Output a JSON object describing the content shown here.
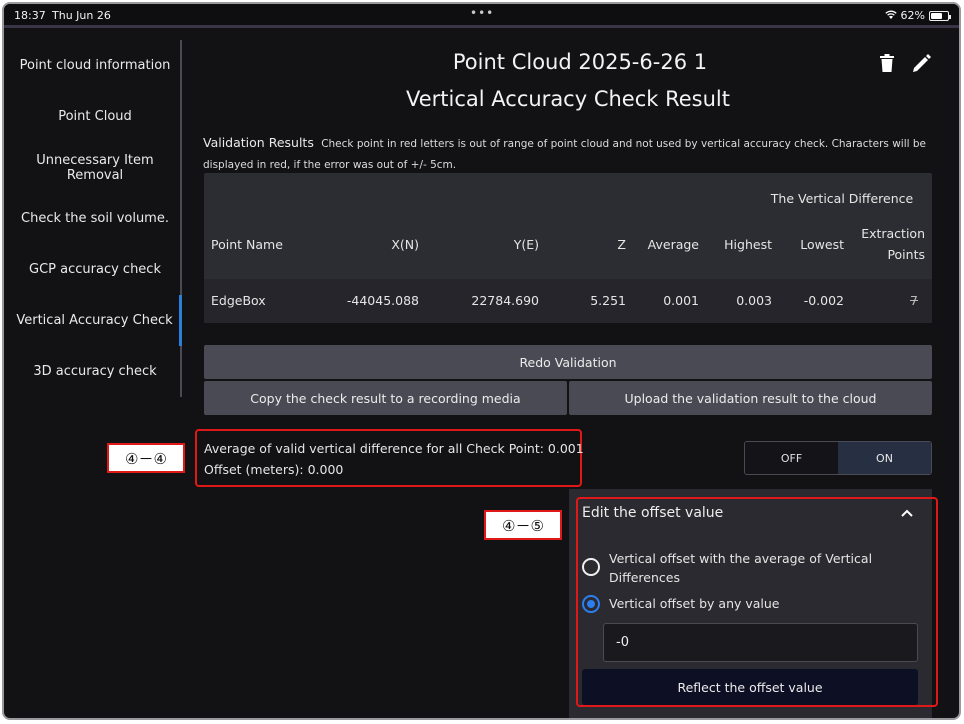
{
  "status": {
    "time": "18:37",
    "date": "Thu Jun 26",
    "dots": "•••",
    "battery": "62%"
  },
  "sidebar": {
    "items": [
      {
        "label": "Point cloud information"
      },
      {
        "label": "Point Cloud"
      },
      {
        "label": "Unnecessary Item Removal"
      },
      {
        "label": "Check the soil volume."
      },
      {
        "label": "GCP accuracy check"
      },
      {
        "label": "Vertical Accuracy Check",
        "active": true
      },
      {
        "label": "3D accuracy check"
      }
    ]
  },
  "header": {
    "title": "Point Cloud 2025-6-26 1",
    "subtitle": "Vertical Accuracy Check Result",
    "icons": [
      "trash-icon",
      "pencil-icon"
    ]
  },
  "validation": {
    "title": "Validation Results",
    "note": "Check point in red letters is out of range of point cloud and not used by vertical accuracy check. Characters will be displayed in red, if the error was out of +/- 5cm."
  },
  "table": {
    "group_header": "The Vertical Difference",
    "headers": {
      "point_name": "Point Name",
      "x": "X(N)",
      "y": "Y(E)",
      "z": "Z",
      "average": "Average",
      "highest": "Highest",
      "lowest": "Lowest",
      "extraction_1": "Extraction",
      "extraction_2": "Points"
    },
    "rows": [
      {
        "point_name": "EdgeBox",
        "x": "-44045.088",
        "y": "22784.690",
        "z": "5.251",
        "average": "0.001",
        "highest": "0.003",
        "lowest": "-0.002",
        "extraction": "7"
      }
    ]
  },
  "actions": {
    "redo": "Redo Validation",
    "copy": "Copy the check result to a recording media",
    "upload": "Upload the validation result to the cloud"
  },
  "summary": {
    "average": "Average of valid vertical difference for all Check Point: 0.001",
    "offset": "Offset (meters): 0.000"
  },
  "toggle": {
    "off": "OFF",
    "on": "ON",
    "selected": "ON"
  },
  "annotations": {
    "label_1": "④－④",
    "label_2": "④－⑤"
  },
  "offset_panel": {
    "title": "Edit the offset value",
    "option_1": "Vertical offset with the average of Vertical Differences",
    "option_2": "Vertical offset by any value",
    "selected_option": "Vertical offset by any value",
    "input_value": "-0",
    "reflect_button": "Reflect the offset value"
  },
  "colors": {
    "accent": "#2b7ff0",
    "annotation": "#e01818",
    "background": "#121214"
  }
}
